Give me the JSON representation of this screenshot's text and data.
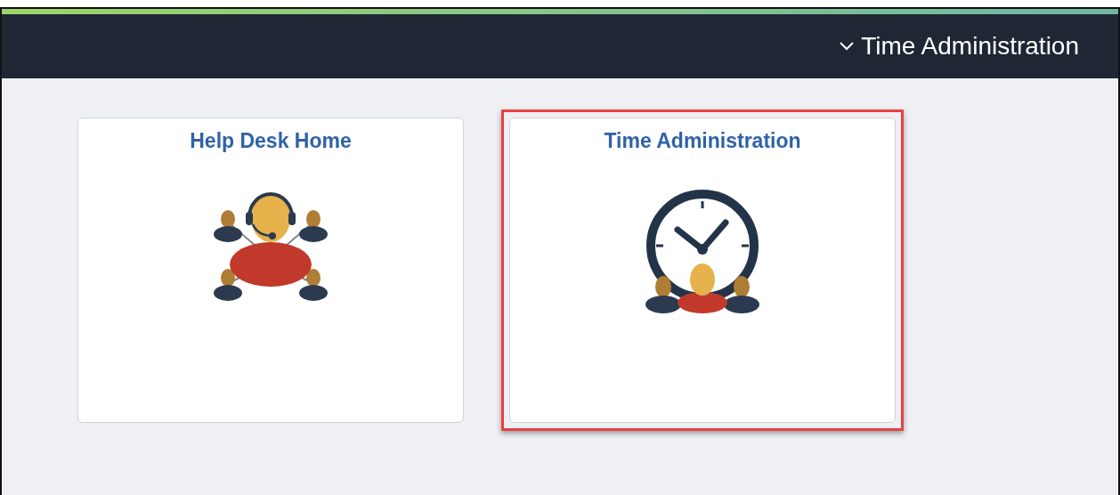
{
  "header": {
    "title": "Time Administration"
  },
  "tiles": [
    {
      "title": "Help Desk Home",
      "kind": "helpdesk",
      "selected": false
    },
    {
      "title": "Time Administration",
      "kind": "time",
      "selected": true
    }
  ]
}
